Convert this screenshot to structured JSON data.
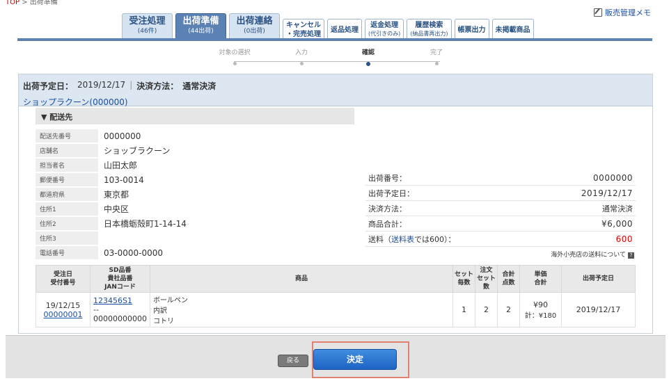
{
  "breadcrumb": {
    "top": "TOP",
    "sep": ">",
    "current": "出荷準備"
  },
  "header": {
    "memo_link": "販売管理メモ"
  },
  "tabs": [
    {
      "label": "受注処理",
      "sub": "(46件)"
    },
    {
      "label": "出荷準備",
      "sub": "(44出荷)"
    },
    {
      "label": "出荷連絡",
      "sub": "(0出荷)"
    }
  ],
  "small_tabs": [
    {
      "label": "キャンセル",
      "sub": "・完売処理"
    },
    {
      "label": "返品処理",
      "sub": ""
    },
    {
      "label": "返金処理",
      "sub": "(代引きのみ)"
    },
    {
      "label": "履歴検索",
      "sub": "(納品書再出力)"
    },
    {
      "label": "帳票出力",
      "sub": ""
    },
    {
      "label": "未掲載商品",
      "sub": ""
    }
  ],
  "steps": [
    {
      "label": "対象の選択"
    },
    {
      "label": "入力"
    },
    {
      "label": "確認"
    },
    {
      "label": "完了"
    }
  ],
  "summary": {
    "date_label": "出荷予定日：",
    "date_value": "2019/12/17",
    "sep": "|",
    "payment_label": "決済方法：",
    "payment_value": "通常決済",
    "shop": "ショップラクーン(000000)"
  },
  "shipping": {
    "section_title": "▼ 配送先",
    "rows": [
      {
        "key": "配送先番号",
        "value": "0000000"
      },
      {
        "key": "店舗名",
        "value": "ショッブラクーン"
      },
      {
        "key": "担当者名",
        "value": "山田太郎"
      },
      {
        "key": "郵便番号",
        "value": "103-0014"
      },
      {
        "key": "都道府県",
        "value": "東京都"
      },
      {
        "key": "住所1",
        "value": "中央区"
      },
      {
        "key": "住所2",
        "value": "日本橋蛎殻町1-14-14"
      },
      {
        "key": "住所3",
        "value": ""
      },
      {
        "key": "電話番号",
        "value": "03-0000-0000"
      }
    ]
  },
  "totals": {
    "rows": [
      {
        "label": "出荷番号：",
        "value": "0000000"
      },
      {
        "label": "出荷予定日：",
        "value": "2019/12/17"
      },
      {
        "label": "決済方法：",
        "value": "通常決済"
      },
      {
        "label": "商品合計：",
        "value": "¥6,000"
      }
    ],
    "shipping_label_pre": "送料（",
    "shipping_link": "送料表",
    "shipping_label_post": "では600）：",
    "shipping_value": "600",
    "note": "海外小売店の送料について"
  },
  "items_table": {
    "headers": {
      "order": "受注日",
      "order2": "受付番号",
      "sd": "SD品番",
      "sd2": "貴社品番",
      "sd3": "JANコード",
      "product": "商品",
      "set": "セット",
      "set2": "毎数",
      "ordset": "注文",
      "ordset2": "セット",
      "ordset3": "数",
      "total": "合計",
      "total2": "点数",
      "unit": "単価",
      "unit2": "合計",
      "ship": "出荷予定日"
    },
    "row": {
      "date": "19/12/15",
      "order_no": "00000001",
      "sd": "123456S1",
      "own": "--",
      "jan": "00000000000",
      "product1": "ボールペン",
      "product2": "内訳",
      "product3": "コトリ",
      "set": "1",
      "ordset": "2",
      "total": "2",
      "unit": "¥90",
      "subtotal": "計：¥180",
      "ship": "2019/12/17"
    }
  },
  "footer": {
    "back": "戻る",
    "confirm": "決定"
  }
}
